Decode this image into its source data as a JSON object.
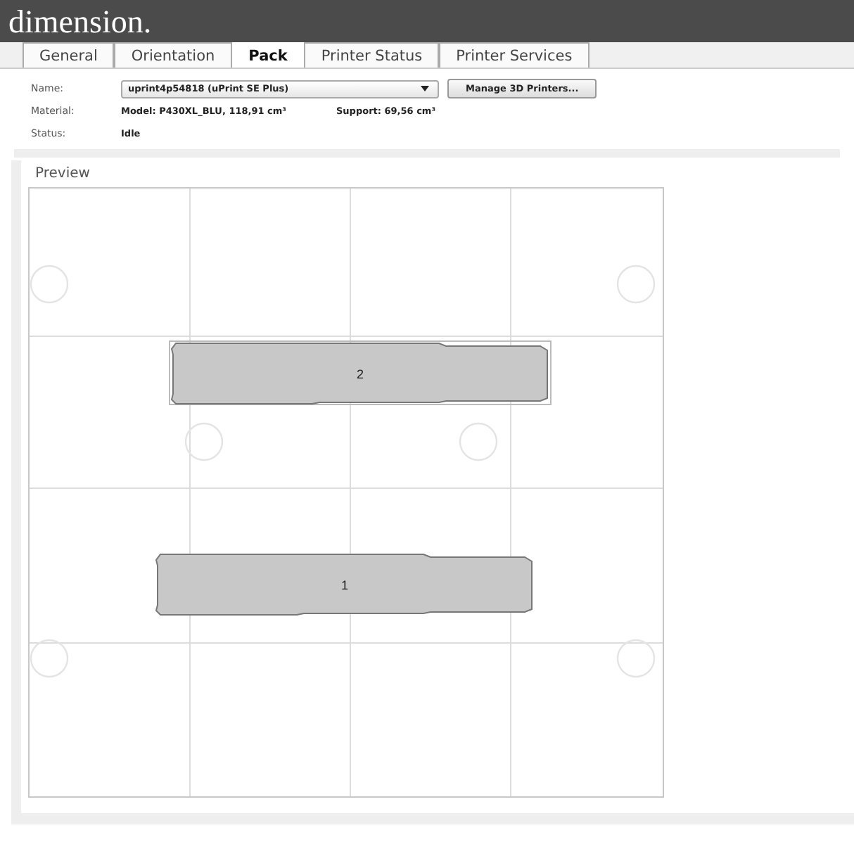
{
  "logo": {
    "text": "dimension."
  },
  "tabs": [
    {
      "label": "General",
      "selected": false
    },
    {
      "label": "Orientation",
      "selected": false
    },
    {
      "label": "Pack",
      "selected": true
    },
    {
      "label": "Printer Status",
      "selected": false
    },
    {
      "label": "Printer Services",
      "selected": false
    }
  ],
  "printer": {
    "name_label": "Name:",
    "name_value": "uprint4p54818  (uPrint SE Plus)",
    "manage_button": "Manage 3D Printers...",
    "material_label": "Material:",
    "material_value": "Model: P430XL_BLU, 118,91 cm³",
    "support_value": "Support: 69,56 cm³",
    "status_label": "Status:",
    "status_value": "Idle"
  },
  "preview": {
    "title": "Preview",
    "parts": [
      {
        "label": "2",
        "selected": true
      },
      {
        "label": "1",
        "selected": false
      }
    ]
  }
}
